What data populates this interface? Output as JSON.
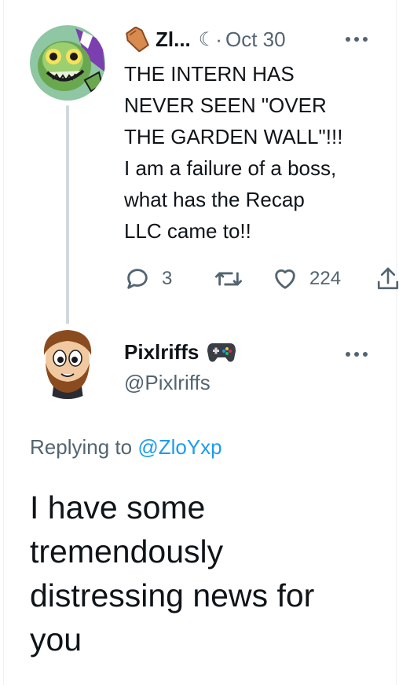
{
  "parent_tweet": {
    "author_name": "Zl...",
    "separator": "·",
    "date": "Oct 30",
    "text": "THE INTERN HAS\nNEVER SEEN \"OVER\nTHE GARDEN WALL\"!!!\nI am a failure of a boss,\nwhat has the Recap\nLLC came to!!",
    "reply_count": "3",
    "like_count": "224",
    "icons": {
      "author_emoji": "coffin-icon",
      "reply": "reply-icon",
      "retweet": "retweet-icon",
      "like": "heart-icon",
      "share": "share-icon",
      "more": "more-icon"
    }
  },
  "reply_tweet": {
    "author_name": "Pixlriffs",
    "author_handle": "@Pixlriffs",
    "replying_prefix": "Replying to",
    "replying_handle": "@ZloYxp",
    "text": "I have some\ntremendously\ndistressing news for\nyou",
    "icons": {
      "author_emoji": "gamepad-icon",
      "more": "more-icon"
    }
  },
  "colors": {
    "text": "#0f1419",
    "secondary": "#536471",
    "link": "#1d9bf0",
    "thread_line": "#cfd9de"
  }
}
